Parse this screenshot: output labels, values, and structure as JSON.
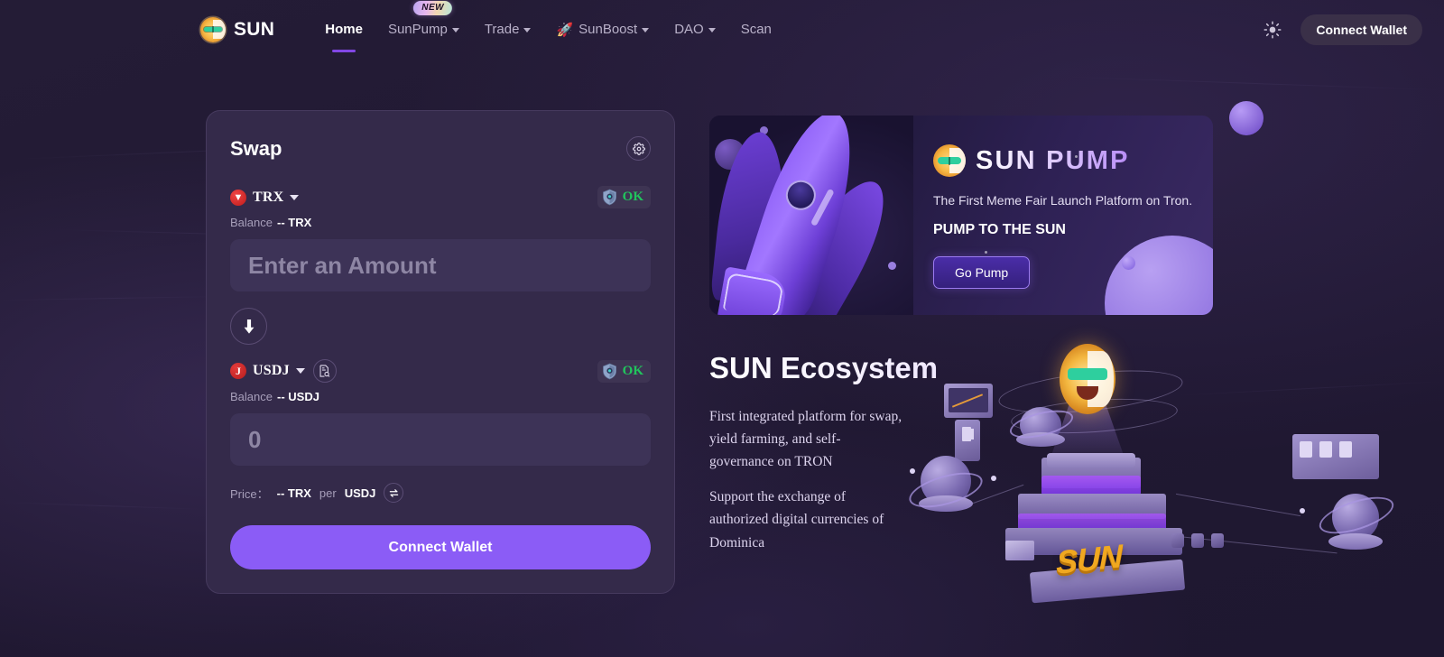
{
  "brand": {
    "name": "SUN",
    "logo_icon": "sun-face-icon"
  },
  "nav": {
    "items": [
      {
        "label": "Home",
        "has_caret": false,
        "badge": null,
        "icon": null,
        "active": true
      },
      {
        "label": "SunPump",
        "has_caret": true,
        "badge": "NEW",
        "icon": null,
        "active": false
      },
      {
        "label": "Trade",
        "has_caret": true,
        "badge": null,
        "icon": null,
        "active": false
      },
      {
        "label": "SunBoost",
        "has_caret": true,
        "badge": null,
        "icon": "rocket-icon",
        "active": false
      },
      {
        "label": "DAO",
        "has_caret": true,
        "badge": null,
        "icon": null,
        "active": false
      },
      {
        "label": "Scan",
        "has_caret": false,
        "badge": null,
        "icon": null,
        "active": false
      }
    ]
  },
  "header_right": {
    "theme_icon": "sun-brightness-icon",
    "connect_label": "Connect Wallet"
  },
  "swap": {
    "title": "Swap",
    "settings_icon": "gear-icon",
    "from": {
      "token": "TRX",
      "token_icon": "trx-token-icon",
      "risk_icon": "shield-icon",
      "risk_label": "OK",
      "balance_label": "Balance",
      "balance_value": "-- TRX",
      "amount_value": "",
      "amount_placeholder": "Enter an Amount"
    },
    "switch_icon": "arrow-down-icon",
    "to": {
      "token": "USDJ",
      "token_icon": "usdj-token-icon",
      "contract_icon": "contract-search-icon",
      "risk_icon": "shield-icon",
      "risk_label": "OK",
      "balance_label": "Balance",
      "balance_value": "-- USDJ",
      "amount_value": "",
      "amount_placeholder": "0"
    },
    "price": {
      "label": "Price：",
      "value": "-- TRX",
      "per": "per",
      "quote": "USDJ",
      "toggle_icon": "price-direction-icon"
    },
    "cta_label": "Connect Wallet"
  },
  "promo": {
    "logo_icon": "sun-face-icon",
    "title": "SUN PUMP",
    "subtitle": "The First Meme Fair Launch Platform on Tron.",
    "tagline": "PUMP TO THE SUN",
    "button_label": "Go Pump",
    "art_icon": "rocket-illustration"
  },
  "ecosystem": {
    "title": "SUN Ecosystem",
    "paragraphs": [
      "First integrated platform for swap, yield farming, and self-governance on TRON",
      "Support the exchange of authorized digital currencies of Dominica"
    ],
    "art_icon": "sun-ecosystem-3d-illustration",
    "art_label": "SUN"
  },
  "colors": {
    "page_bg": "#221a33",
    "card_bg": "#342a4a",
    "input_bg": "#3d3357",
    "accent": "#8b5cf6",
    "ok_green": "#21c55d",
    "nav_underline": "#8247e5"
  }
}
